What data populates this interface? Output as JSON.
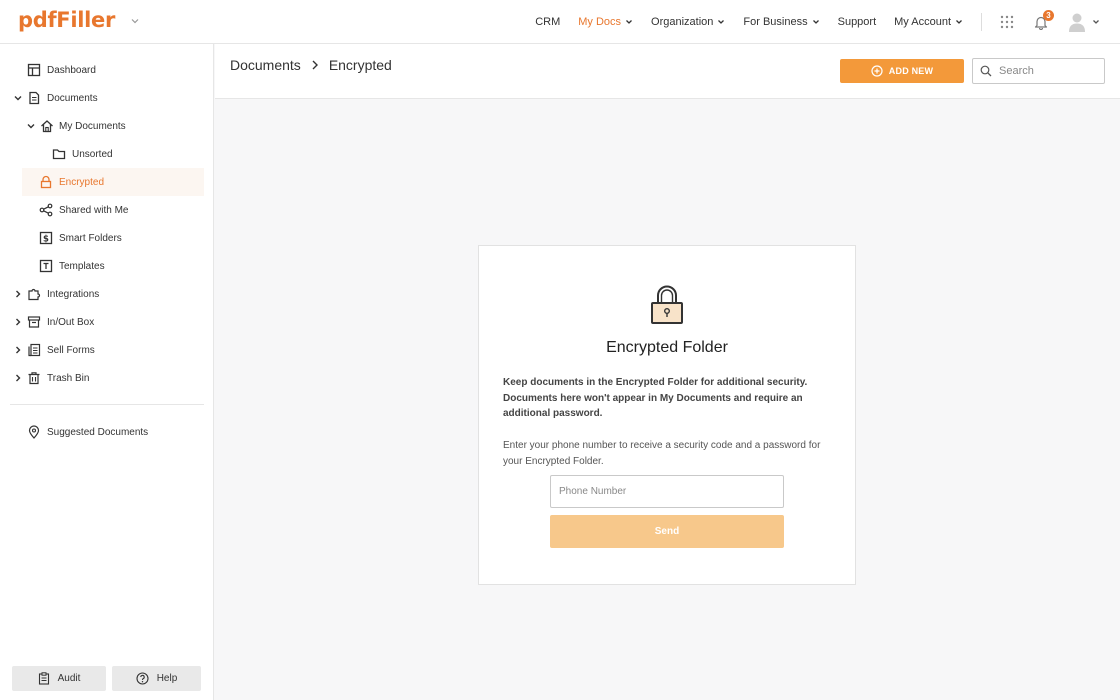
{
  "header": {
    "logo": "pdfFiller",
    "nav": [
      {
        "label": "CRM"
      },
      {
        "label": "My Docs",
        "active": true
      },
      {
        "label": "Organization"
      },
      {
        "label": "For Business"
      },
      {
        "label": "Support"
      },
      {
        "label": "My Account"
      }
    ],
    "notifications_count": "3",
    "accent_color": "#e8772e"
  },
  "sidebar": {
    "items": [
      {
        "label": "Dashboard",
        "icon": "dashboard-icon"
      },
      {
        "label": "Documents",
        "icon": "document-icon",
        "expanded": true
      },
      {
        "label": "My Documents",
        "icon": "home-icon",
        "expanded": true
      },
      {
        "label": "Unsorted",
        "icon": "folder-icon"
      },
      {
        "label": "Encrypted",
        "icon": "lock-icon",
        "active": true
      },
      {
        "label": "Shared with Me",
        "icon": "share-icon"
      },
      {
        "label": "Smart Folders",
        "icon": "smart-folder-icon"
      },
      {
        "label": "Templates",
        "icon": "template-icon"
      },
      {
        "label": "Integrations",
        "icon": "puzzle-icon"
      },
      {
        "label": "In/Out Box",
        "icon": "inbox-icon"
      },
      {
        "label": "Sell Forms",
        "icon": "sell-forms-icon"
      },
      {
        "label": "Trash Bin",
        "icon": "trash-icon"
      }
    ],
    "suggested": "Suggested Documents",
    "audit": "Audit",
    "help": "Help"
  },
  "main": {
    "breadcrumb": [
      "Documents",
      "Encrypted"
    ],
    "add_new": "ADD NEW",
    "search_placeholder": "Search"
  },
  "card": {
    "title": "Encrypted Folder",
    "description": "Keep documents in the Encrypted Folder for additional security. Documents here won't appear in My Documents and require an additional password.",
    "note": "Enter your phone number to receive a security code and a password for your Encrypted Folder.",
    "phone_placeholder": "Phone Number",
    "send": "Send"
  }
}
